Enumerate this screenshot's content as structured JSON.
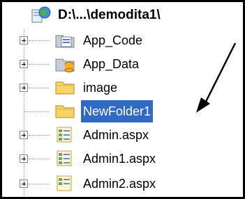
{
  "tree": {
    "root": {
      "label": "D:\\...\\demodita1\\"
    },
    "items": [
      {
        "label": "App_Code",
        "icon": "app-code-folder-icon",
        "expandable": true
      },
      {
        "label": "App_Data",
        "icon": "app-data-folder-icon",
        "expandable": true
      },
      {
        "label": "image",
        "icon": "folder-icon",
        "expandable": true
      },
      {
        "label": "NewFolder1",
        "icon": "folder-icon",
        "expandable": false,
        "selected": true
      },
      {
        "label": "Admin.aspx",
        "icon": "aspx-file-icon",
        "expandable": true
      },
      {
        "label": "Admin1.aspx",
        "icon": "aspx-file-icon",
        "expandable": true
      },
      {
        "label": "Admin2.aspx",
        "icon": "aspx-file-icon",
        "expandable": true
      }
    ]
  },
  "colors": {
    "selection": "#316ac5",
    "selection_text": "#ffffff",
    "folder": "#f5d46a",
    "arrow": "#000000"
  }
}
